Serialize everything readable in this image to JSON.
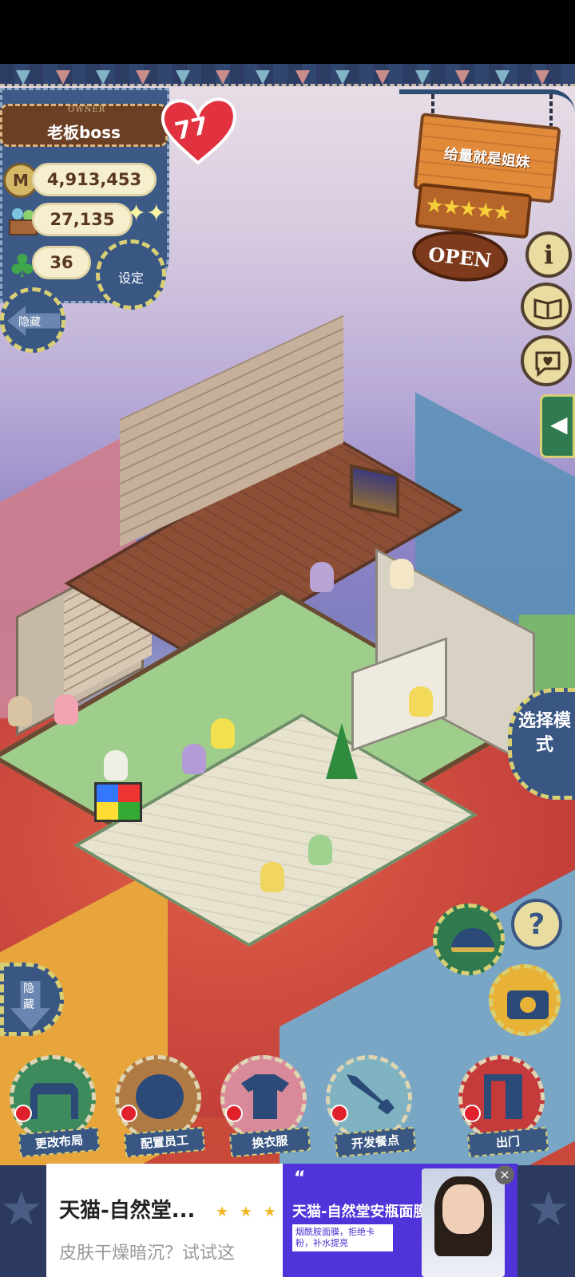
{
  "owner": {
    "title_small": "OWNER",
    "name": "老板boss",
    "hearts": "77",
    "coins": "4,913,453",
    "food": "27,135",
    "clovers": "36",
    "settings_label": "设定",
    "hide_label": "隐藏"
  },
  "sign": {
    "name": "给量就是姐妹",
    "stars": "★★★★★",
    "open_label": "OPEN"
  },
  "side": {
    "info_glyph": "i",
    "mode_label": "选择模式",
    "hide_label": "隐藏",
    "help_glyph": "?"
  },
  "actions": [
    {
      "label": "更改布局",
      "icon": "table-icon",
      "color": "#3d8a5c"
    },
    {
      "label": "配置员工",
      "icon": "bear-icon",
      "color": "#b07a44"
    },
    {
      "label": "换衣服",
      "icon": "shirt-icon",
      "color": "#d88a9a"
    },
    {
      "label": "开发餐点",
      "icon": "knife-icon",
      "color": "#7fb3c2"
    },
    {
      "label": "出门",
      "icon": "door-icon",
      "color": "#c53b3b"
    }
  ],
  "ad": {
    "title": "天猫-自然堂...",
    "rating": "★ ★ ★ ★",
    "subtitle": "皮肤干燥暗沉？试试这",
    "banner_quote": "“",
    "banner_title": "天猫-自然堂安瓶面膜",
    "banner_desc": "烟酰胺面膜，拒绝卡粉，补水提亮"
  }
}
